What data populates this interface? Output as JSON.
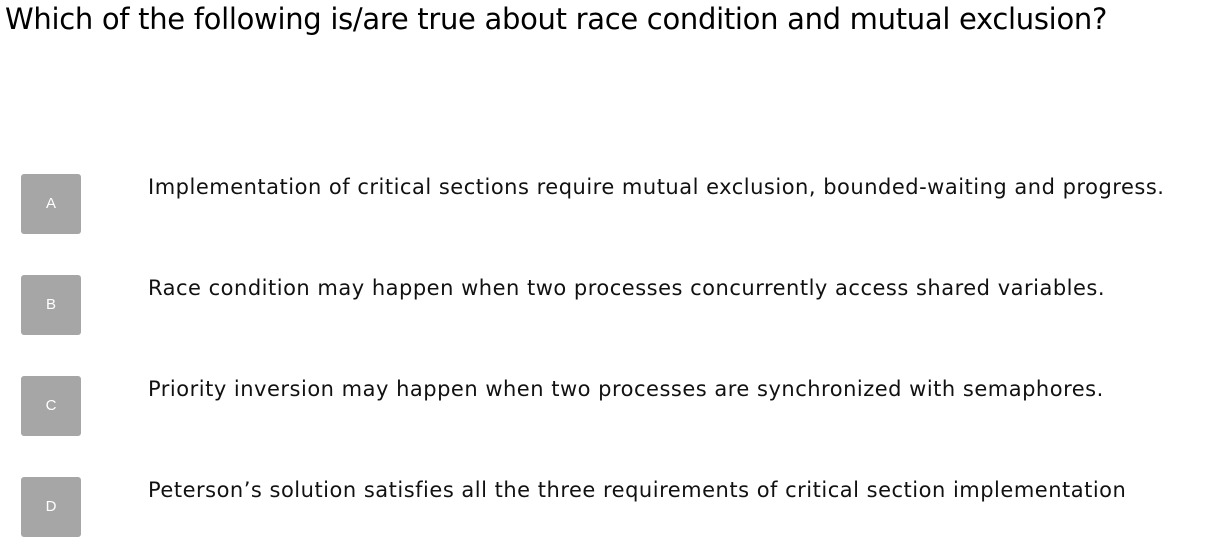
{
  "question": {
    "text": "Which of the following is/are true about race condition and mutual exclusion?"
  },
  "options": [
    {
      "letter": "A",
      "text": "Implementation of critical sections require mutual exclusion, bounded-waiting and progress."
    },
    {
      "letter": "B",
      "text": "Race condition may happen when two processes concurrently access shared variables."
    },
    {
      "letter": "C",
      "text": "Priority inversion may happen when two processes are synchronized with semaphores."
    },
    {
      "letter": "D",
      "text": "Peterson’s solution satisfies all the three requirements of critical section implementation"
    }
  ],
  "colors": {
    "badge_background": "#a6a6a6",
    "badge_text": "#ffffff",
    "text": "#000000"
  }
}
